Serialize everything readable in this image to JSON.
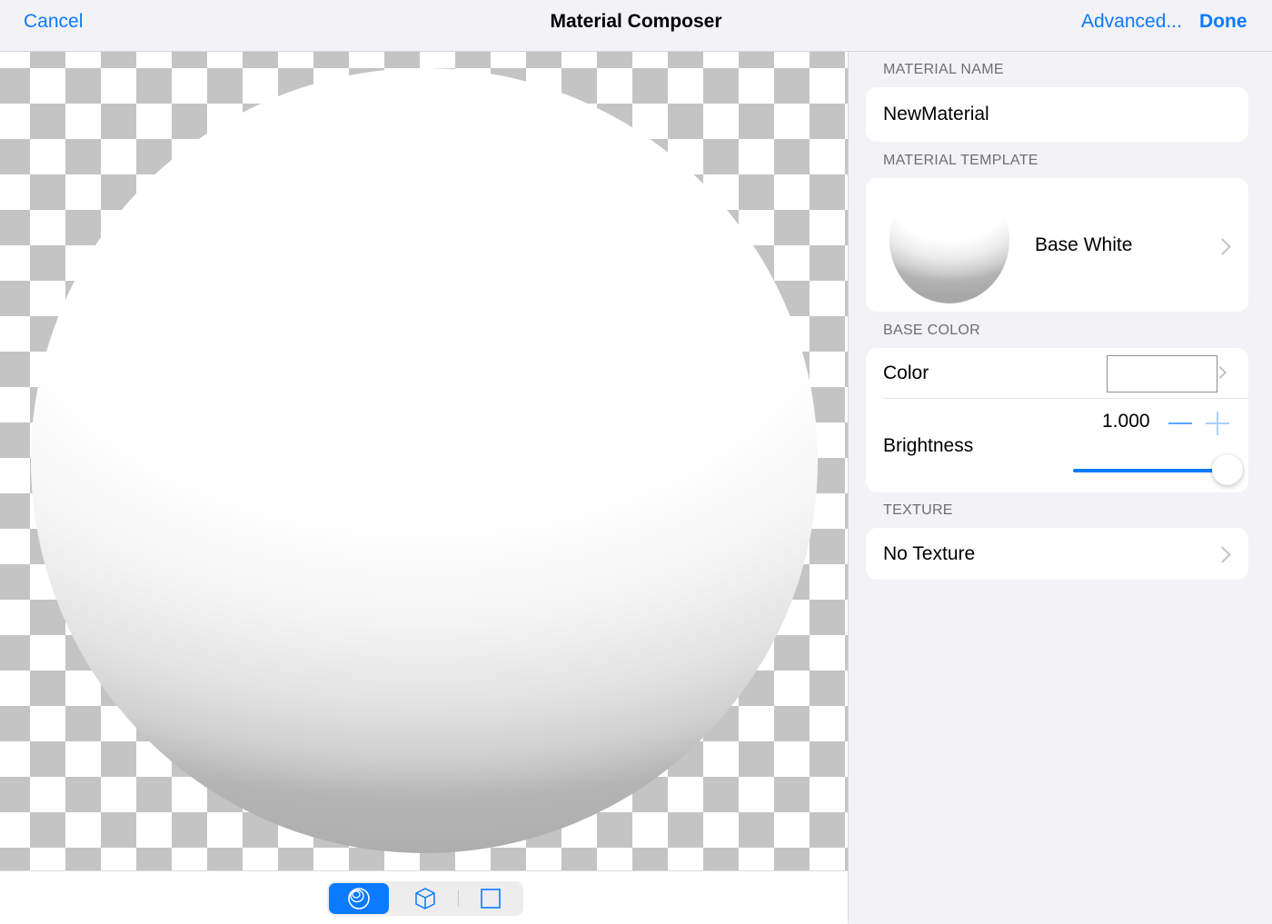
{
  "navbar": {
    "title": "Material Composer",
    "cancel_label": "Cancel",
    "advanced_label": "Advanced...",
    "done_label": "Done"
  },
  "viewport": {
    "preview_shapes": [
      {
        "name": "sphere",
        "icon": "sphere-icon",
        "selected": true
      },
      {
        "name": "cube",
        "icon": "cube-icon",
        "selected": false
      },
      {
        "name": "plane",
        "icon": "square-icon",
        "selected": false
      }
    ]
  },
  "panel": {
    "material_name": {
      "header": "MATERIAL NAME",
      "value": "NewMaterial"
    },
    "material_template": {
      "header": "MATERIAL TEMPLATE",
      "value": "Base White",
      "icon": "chevron-right-icon"
    },
    "base_color": {
      "header": "BASE COLOR",
      "color_label": "Color",
      "color_value": "#ffffff",
      "brightness_label": "Brightness",
      "brightness_value": "1.000",
      "brightness_fraction": 1.0
    },
    "texture": {
      "header": "TEXTURE",
      "value": "No Texture",
      "icon": "chevron-right-icon"
    }
  },
  "colors": {
    "accent": "#0a7aff",
    "background": "#f2f2f7",
    "checker_dark": "#c4c4c4"
  }
}
